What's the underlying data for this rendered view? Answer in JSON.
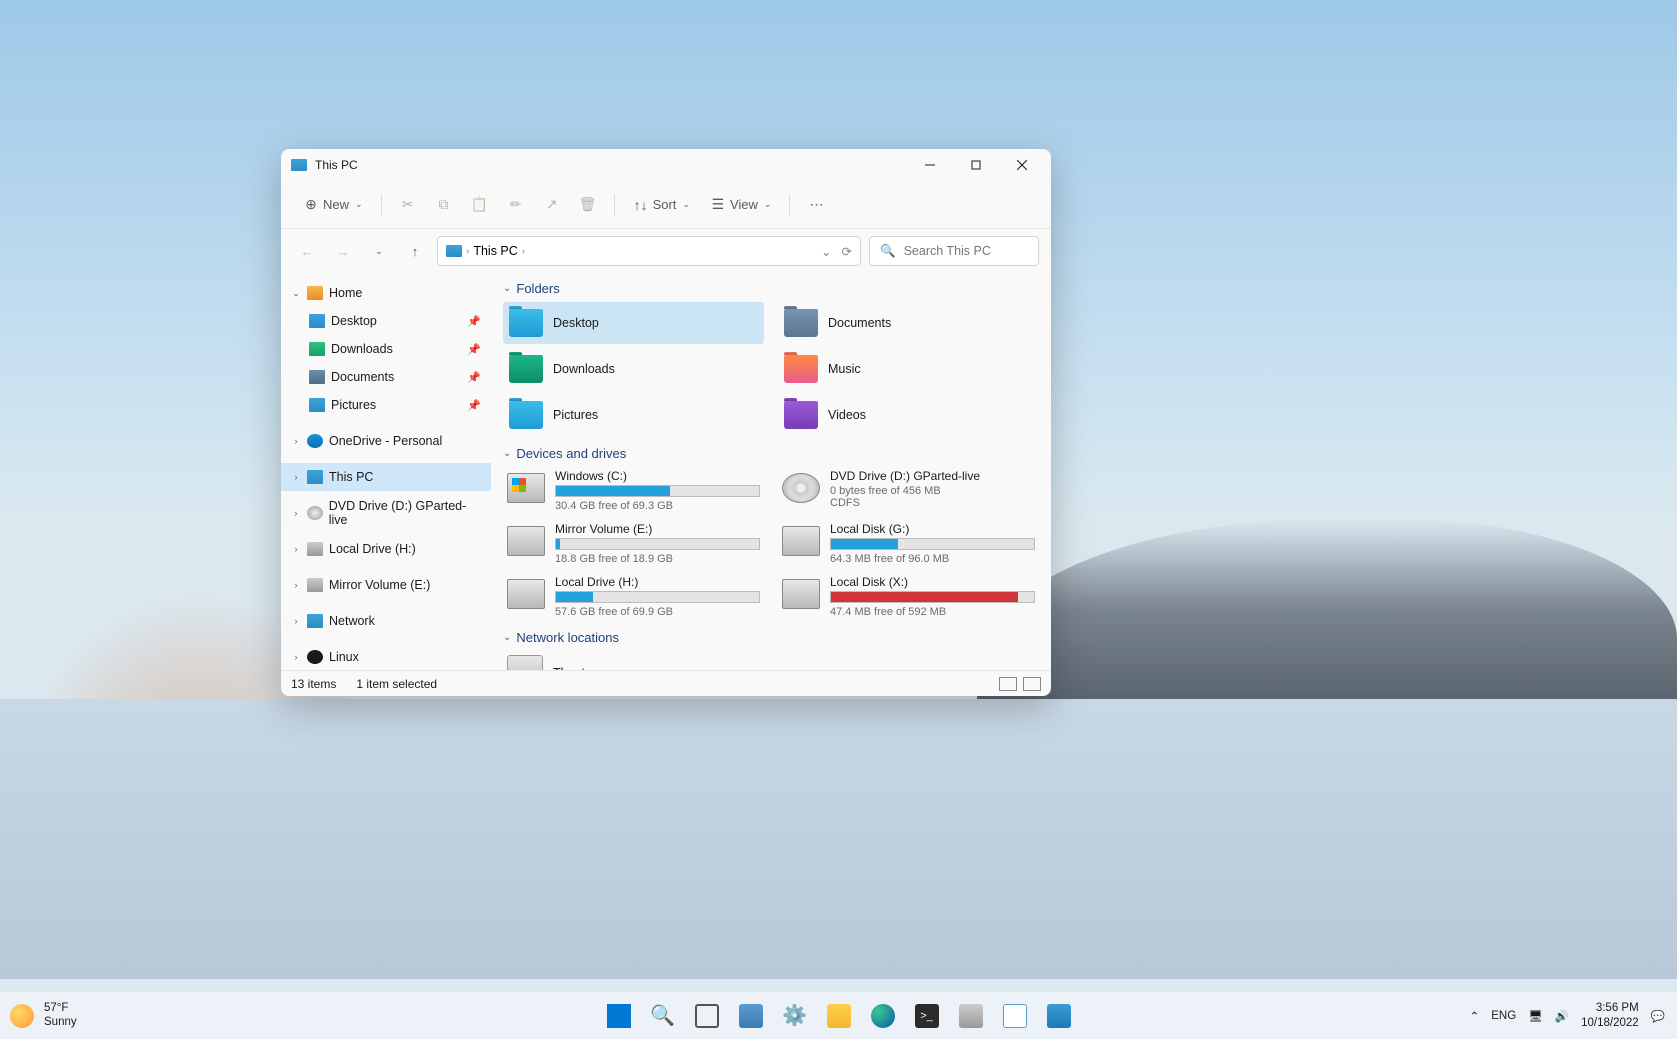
{
  "window": {
    "title": "This PC",
    "toolbar": {
      "new": "New",
      "sort": "Sort",
      "view": "View"
    },
    "breadcrumb": "This PC",
    "search_placeholder": "Search This PC"
  },
  "sidebar": {
    "home": "Home",
    "quick": {
      "desktop": "Desktop",
      "downloads": "Downloads",
      "documents": "Documents",
      "pictures": "Pictures"
    },
    "onedrive": "OneDrive - Personal",
    "thispc": "This PC",
    "dvd": "DVD Drive (D:) GParted-live",
    "localh": "Local Drive (H:)",
    "mirrore": "Mirror Volume (E:)",
    "network": "Network",
    "linux": "Linux"
  },
  "sections": {
    "folders": "Folders",
    "drives": "Devices and drives",
    "network": "Network locations"
  },
  "folders": {
    "desktop": "Desktop",
    "documents": "Documents",
    "downloads": "Downloads",
    "music": "Music",
    "pictures": "Pictures",
    "videos": "Videos"
  },
  "drives": {
    "c": {
      "name": "Windows (C:)",
      "free": "30.4 GB free of 69.3 GB",
      "pct": 56
    },
    "d": {
      "name": "DVD Drive (D:) GParted-live",
      "free": "0 bytes free of 456 MB",
      "fs": "CDFS"
    },
    "e": {
      "name": "Mirror Volume (E:)",
      "free": "18.8 GB free of 18.9 GB",
      "pct": 2
    },
    "g": {
      "name": "Local Disk (G:)",
      "free": "64.3 MB free of 96.0 MB",
      "pct": 33
    },
    "h": {
      "name": "Local Drive (H:)",
      "free": "57.6 GB free of 69.9 GB",
      "pct": 18
    },
    "x": {
      "name": "Local Disk (X:)",
      "free": "47.4 MB free of 592 MB",
      "pct": 92
    }
  },
  "network_locations": {
    "theater": "Theater"
  },
  "statusbar": {
    "count": "13 items",
    "selected": "1 item selected"
  },
  "taskbar": {
    "weather": {
      "temp": "57°F",
      "status": "Sunny"
    },
    "tray": {
      "lang": "ENG",
      "time": "3:56 PM",
      "date": "10/18/2022"
    }
  }
}
